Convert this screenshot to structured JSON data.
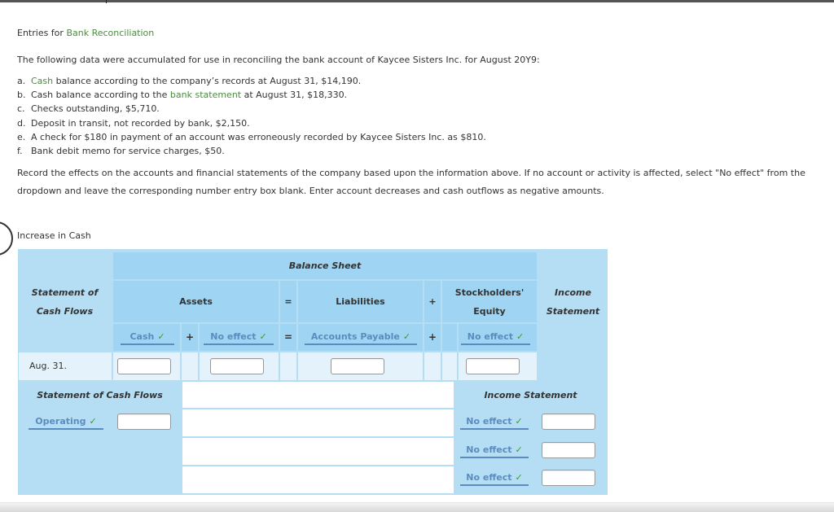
{
  "title": {
    "prefix": "Entries for ",
    "link": "Bank Reconciliation"
  },
  "intro": "The following data were accumulated for use in reconciling the bank account of Kaycee Sisters Inc. for August 20Y9:",
  "items": [
    {
      "label": "a.",
      "link": "Cash",
      "text": " balance according to the company’s records at August 31, $14,190."
    },
    {
      "label": "b.",
      "pre": "Cash balance according to the ",
      "link": "bank statement",
      "text": " at August 31, $18,330."
    },
    {
      "label": "c.",
      "text": "Checks outstanding, $5,710."
    },
    {
      "label": "d.",
      "text": "Deposit in transit, not recorded by bank, $2,150."
    },
    {
      "label": "e.",
      "text": "A check for $180 in payment of an account was erroneously recorded by Kaycee Sisters Inc. as $810."
    },
    {
      "label": "f.",
      "text": "Bank debit memo for service charges, $50."
    }
  ],
  "instructions": {
    "line1": "Record the effects on the accounts and financial statements of the company based upon the information above. If no account or activity is affected, select \"No effect\" from the",
    "line2": "dropdown and leave the corresponding number entry box blank. Enter account decreases and cash outflows as negative amounts."
  },
  "section_title": "Increase in Cash",
  "table": {
    "scf_header_line1": "Statement of",
    "scf_header_line2": "Cash Flows",
    "balance_sheet": "Balance Sheet",
    "assets": "Assets",
    "liabilities": "Liabilities",
    "equity_line1": "Stockholders'",
    "equity_line2": "Equity",
    "income_line1": "Income",
    "income_line2": "Statement",
    "eq": "=",
    "plus": "+",
    "check": "✓",
    "selects": {
      "asset1": "Cash",
      "asset2": "No effect",
      "liability": "Accounts Payable",
      "equity": "No effect"
    },
    "row_label": "Aug. 31.",
    "inputs": {
      "cash": "",
      "asset2": "",
      "liability": "",
      "equity": ""
    },
    "scf_section": "Statement of Cash Flows",
    "scf_select": "Operating",
    "scf_input": "",
    "is_section": "Income Statement",
    "is_rows": [
      {
        "select": "No effect",
        "value": ""
      },
      {
        "select": "No effect",
        "value": ""
      },
      {
        "select": "No effect",
        "value": ""
      }
    ]
  }
}
